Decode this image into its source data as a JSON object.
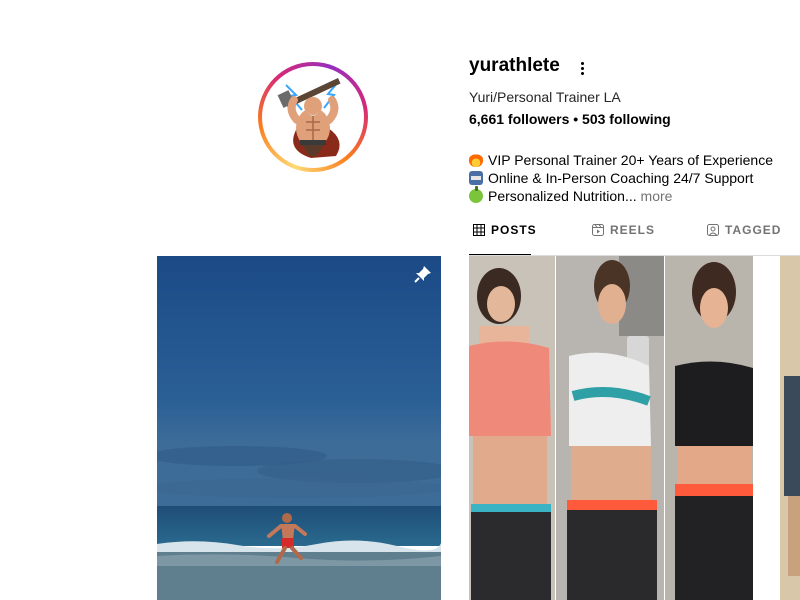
{
  "profile": {
    "username": "yurathlete",
    "full_name": "Yuri/Personal Trainer LA",
    "stats": "6,661 followers • 503 following",
    "avatar_icon": "cartoon-warrior-avatar",
    "bio": {
      "line1": "VIP Personal Trainer 20+ Years of Experience",
      "line2": "Online & In-Person Coaching 24/7 Support",
      "line3": "Personalized Nutrition...",
      "more": "more",
      "line1_icon": "fire-emoji",
      "line2_icon": "weightlifter-emoji",
      "line3_icon": "green-apple-emoji"
    }
  },
  "tabs": [
    {
      "label": "POSTS",
      "icon": "grid-icon",
      "active": true
    },
    {
      "label": "REELS",
      "icon": "reels-icon",
      "active": false
    },
    {
      "label": "TAGGED",
      "icon": "tagged-icon",
      "active": false
    }
  ],
  "posts": [
    {
      "kind": "beach-sprint-photo",
      "pinned": true,
      "icon": "pin-icon"
    },
    {
      "kind": "three-mirror-selfies-photo",
      "pinned": false
    },
    {
      "kind": "partial-photo",
      "pinned": false
    }
  ],
  "colors": {
    "ring_gradient": [
      "#feda75",
      "#fa7e1e",
      "#d62976",
      "#962fbf"
    ],
    "muted_text": "#737373",
    "divider": "#dbdbdb",
    "sea": "#1c4a7a",
    "sky": "#1d4e88"
  }
}
